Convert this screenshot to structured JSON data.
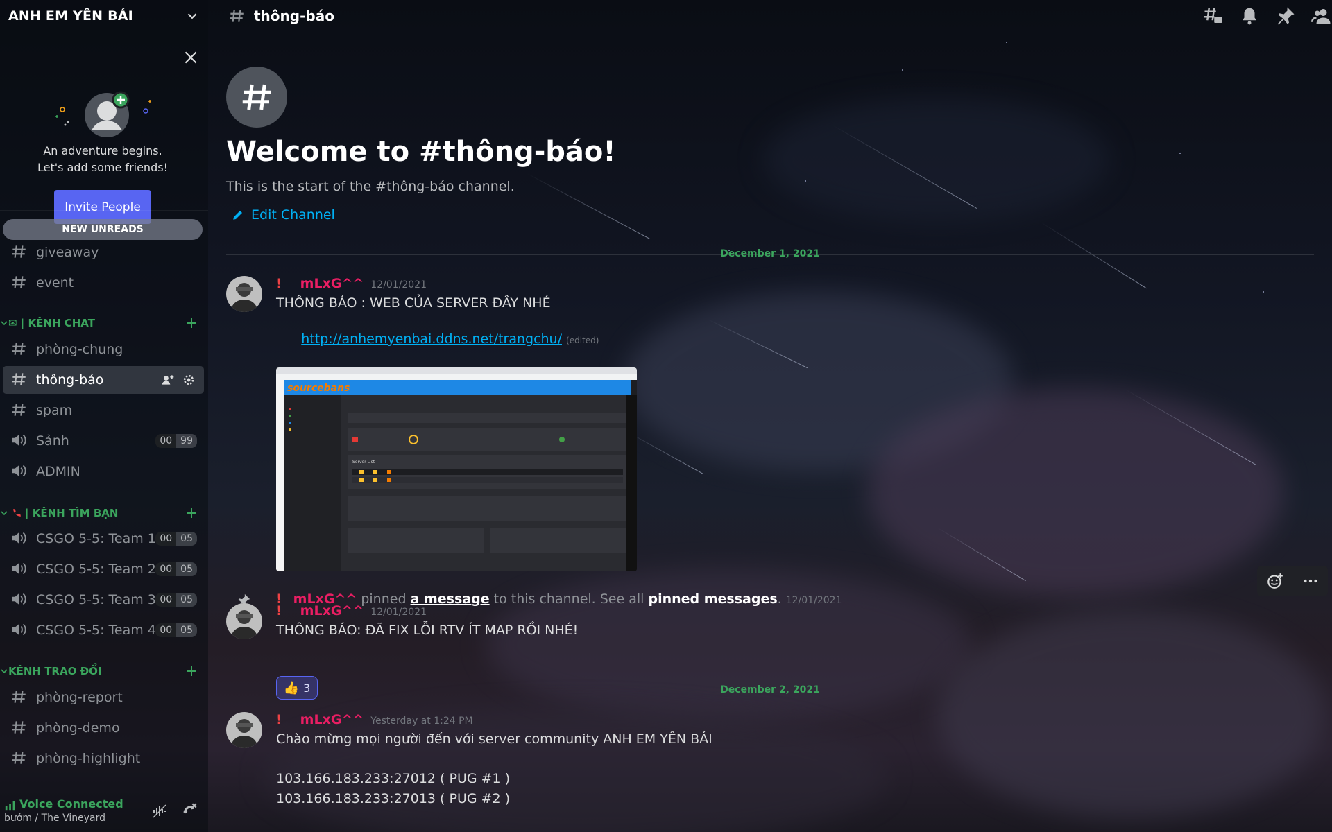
{
  "server": {
    "name": "ANH EM YÊN BÁI"
  },
  "invite": {
    "line1": "An adventure begins.",
    "line2": "Let's add some friends!",
    "button": "Invite People"
  },
  "new_unreads": "NEW UNREADS",
  "channels_top": [
    {
      "name": "giveaway",
      "type": "text"
    },
    {
      "name": "event",
      "type": "text"
    }
  ],
  "categories": [
    {
      "label": "✉ | KÊNH CHAT",
      "channels": [
        {
          "name": "phòng-chung",
          "type": "text"
        },
        {
          "name": "thông-báo",
          "type": "text",
          "active": true
        },
        {
          "name": "spam",
          "type": "text"
        },
        {
          "name": "Sảnh",
          "type": "voice",
          "counts": [
            "00",
            "99"
          ]
        },
        {
          "name": "ADMIN",
          "type": "voice"
        }
      ]
    },
    {
      "label": "| KÊNH TÌM BẠN",
      "channels": [
        {
          "name": "CSGO 5-5: Team 1",
          "type": "voice",
          "counts": [
            "00",
            "05"
          ]
        },
        {
          "name": "CSGO 5-5: Team 2",
          "type": "voice",
          "counts": [
            "00",
            "05"
          ]
        },
        {
          "name": "CSGO 5-5: Team 3",
          "type": "voice",
          "counts": [
            "00",
            "05"
          ]
        },
        {
          "name": "CSGO 5-5: Team 4",
          "type": "voice",
          "counts": [
            "00",
            "05"
          ]
        }
      ]
    },
    {
      "label": "KÊNH TRAO ĐỔI",
      "channels": [
        {
          "name": "phòng-report",
          "type": "text"
        },
        {
          "name": "phòng-demo",
          "type": "text"
        },
        {
          "name": "phòng-highlight",
          "type": "text"
        }
      ]
    }
  ],
  "voice": {
    "status": "Voice Connected",
    "location": "bướm / The Vineyard"
  },
  "header": {
    "channel": "thông-báo"
  },
  "welcome": {
    "title": "Welcome to #thông-báo!",
    "subtitle": "This is the start of the #thông-báo channel.",
    "edit": "Edit Channel"
  },
  "dates": {
    "d1": "December 1, 2021",
    "d2": "December 2, 2021"
  },
  "messages": {
    "m1": {
      "author": "mLxG^^",
      "time": "12/01/2021",
      "text": "THÔNG BÁO : WEB CỦA SERVER ĐÂY NHÉ",
      "link": "http://anhemyenbai.ddns.net/trangchu/",
      "edited": "(edited)"
    },
    "pin": {
      "author": "mLxG^^",
      "pre": "pinned",
      "link": "a message",
      "mid": "to this channel. See all",
      "bold": "pinned messages",
      "end": ".",
      "time": "12/01/2021"
    },
    "m2": {
      "author": "mLxG^^",
      "time": "12/01/2021",
      "text": "THÔNG BÁO: ĐÃ FIX LỖI RTV ÍT MAP RỒI NHÉ!",
      "reaction_count": "3"
    },
    "m3": {
      "author": "mLxG^^",
      "time": "Yesterday at 1:24 PM",
      "line1": "Chào mừng mọi người đến với server community ANH EM YÊN BÁI",
      "line2": "103.166.183.233:27012 ( PUG #1 )",
      "line3": "103.166.183.233:27013 ( PUG #2 )"
    }
  },
  "embed": {
    "brand": "sourcebans",
    "table_title": "Server List"
  },
  "colors": {
    "accent": "#5865f2",
    "green": "#3ba55d",
    "username": "#e91e63",
    "link": "#00b0f4"
  }
}
